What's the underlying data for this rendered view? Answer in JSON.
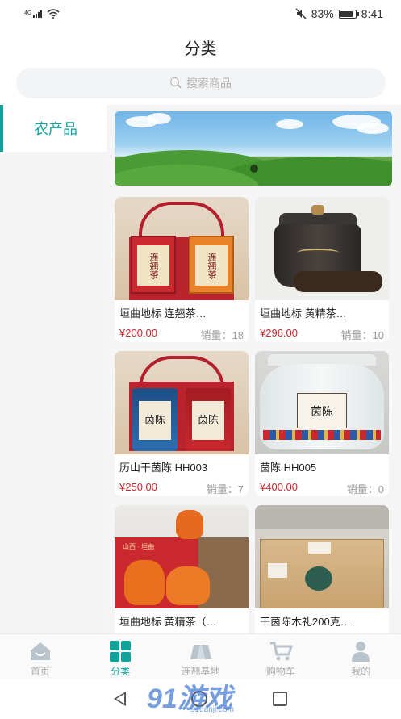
{
  "status": {
    "network": "4G",
    "battery": "83%",
    "battery_level": 0.83,
    "time": "8:41"
  },
  "page_title": "分类",
  "search": {
    "placeholder": "搜索商品"
  },
  "sidebar": {
    "items": [
      {
        "label": "农产品",
        "active": true
      }
    ]
  },
  "products": [
    {
      "name": "垣曲地标 连翘茶…",
      "price": "¥200.00",
      "sales_label": "销量：",
      "sales": "18"
    },
    {
      "name": "垣曲地标 黄精茶…",
      "price": "¥296.00",
      "sales_label": "销量：",
      "sales": "10"
    },
    {
      "name": "历山干茵陈 HH003",
      "price": "¥250.00",
      "sales_label": "销量：",
      "sales": "7"
    },
    {
      "name": "茵陈 HH005",
      "price": "¥400.00",
      "sales_label": "销量：",
      "sales": "0"
    },
    {
      "name": "垣曲地标 黄精茶（…",
      "price": "",
      "sales_label": "",
      "sales": ""
    },
    {
      "name": "干茵陈木礼200克…",
      "price": "",
      "sales_label": "",
      "sales": ""
    }
  ],
  "product_images": {
    "p1_box_left": "连翘茶",
    "p1_box_right": "连翘茶",
    "p3_can_left": "茵陈",
    "p3_can_right": "茵陈",
    "p4_label": "茵陈",
    "p5_box": "山西 · 垣曲"
  },
  "tabs": [
    {
      "label": "首页",
      "icon": "home-icon",
      "active": false
    },
    {
      "label": "分类",
      "icon": "category-grid-icon",
      "active": true
    },
    {
      "label": "连翘基地",
      "icon": "base-icon",
      "active": false
    },
    {
      "label": "购物车",
      "icon": "cart-icon",
      "active": false
    },
    {
      "label": "我的",
      "icon": "profile-icon",
      "active": false
    }
  ],
  "watermark": {
    "brand": "91游戏",
    "url": "91danji.com"
  },
  "colors": {
    "accent": "#11a29c",
    "price": "#c8282e",
    "muted": "#999999"
  }
}
